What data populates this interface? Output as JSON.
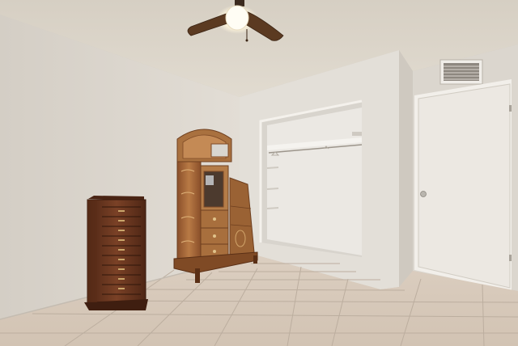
{
  "scene": {
    "description_type": "photo-of-room",
    "watermark": "",
    "palette": {
      "ceiling": "#ddd6cb",
      "left_wall": "#dcd7cf",
      "back_wall": "#e4e0d9",
      "right_wall": "#d8d3cb",
      "closet_interior": "#e9e6e1",
      "door": "#ece8e2",
      "floor_tile": "#d9cbbb",
      "grout": "#bfb1a2",
      "wood_dark": "#6b3a22",
      "wood_mid": "#a36a3c",
      "wood_light": "#c48a55",
      "fan_blade": "#5a3a22",
      "light_glow": "#fff8e6"
    },
    "objects": [
      "ceiling-fan",
      "hvac-vent",
      "jewelry-armoire",
      "ornate-wardrobe",
      "open-closet",
      "closet-door",
      "tile-floor"
    ]
  }
}
